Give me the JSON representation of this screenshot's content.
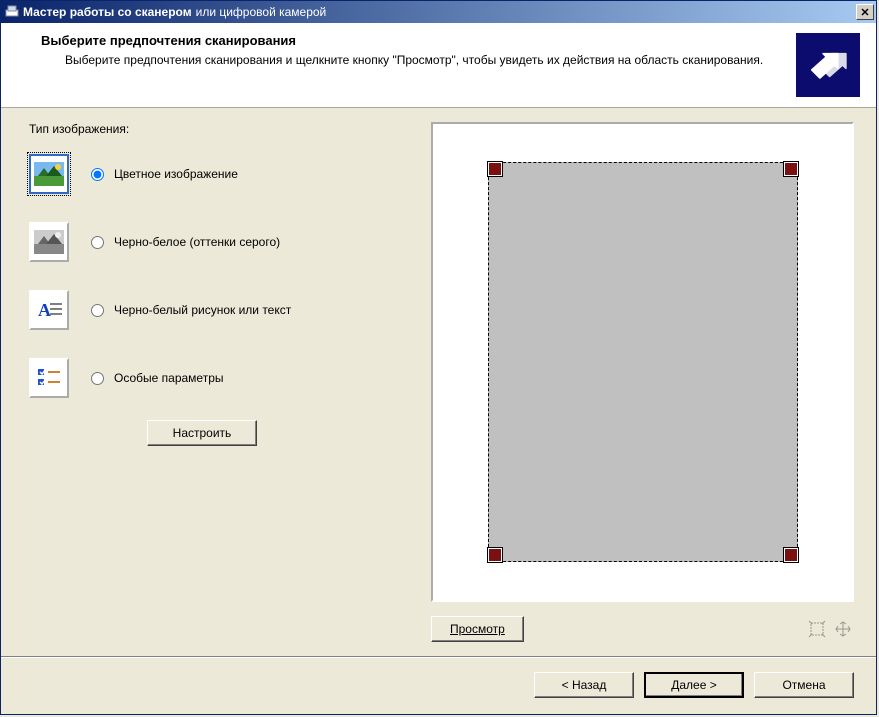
{
  "titlebar": {
    "icon": "scanner-icon",
    "title_strong": "Мастер работы со сканером",
    "title_rest": "или цифровой камерой",
    "close": "×"
  },
  "header": {
    "title": "Выберите предпочтения сканирования",
    "description": "Выберите предпочтения сканирования и щелкните кнопку \"Просмотр\", чтобы увидеть их действия на область сканирования."
  },
  "group_label": "Тип изображения:",
  "options": {
    "color": "Цветное изображение",
    "gray": "Черно-белое (оттенки серого)",
    "bw": "Черно-белый рисунок или текст",
    "custom": "Особые параметры"
  },
  "configure_btn": "Настроить",
  "preview_btn": "Просмотр",
  "tools": {
    "fit": "zoom-fit-icon",
    "fill": "zoom-fill-icon"
  },
  "footer": {
    "back": "< Назад",
    "next": "Далее >",
    "cancel": "Отмена"
  }
}
